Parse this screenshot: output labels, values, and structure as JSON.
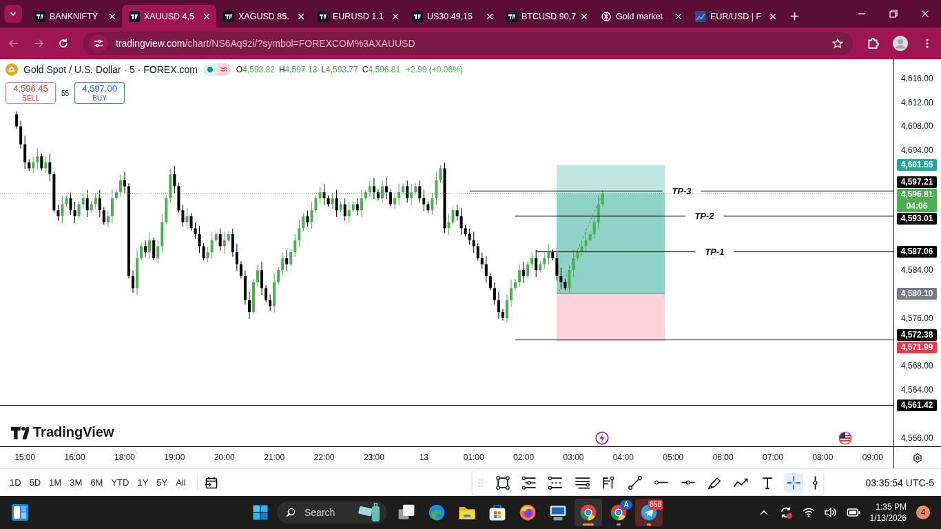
{
  "browser": {
    "tabs": [
      {
        "kind": "tradingview",
        "title": "BANKNIFTY",
        "selected": false
      },
      {
        "kind": "tradingview",
        "title": "XAUUSD 4,5",
        "selected": true
      },
      {
        "kind": "tradingview",
        "title": "XAGUSD 85.",
        "selected": false
      },
      {
        "kind": "tradingview",
        "title": "EURUSD 1.1",
        "selected": false
      },
      {
        "kind": "tradingview",
        "title": "US30 49,15",
        "selected": false
      },
      {
        "kind": "tradingview",
        "title": "BTCUSD 90,7",
        "selected": false
      },
      {
        "kind": "assistant",
        "title": "Gold market",
        "selected": false
      },
      {
        "kind": "news",
        "title": "EUR/USD | F",
        "selected": false
      }
    ],
    "back": {
      "disabled": true
    },
    "forward": {
      "disabled": true
    },
    "address_bar": {
      "domain": "tradingview.com",
      "path": "/chart/NS6Aq9zi/?symbol=FOREXCOM%3AXAUUSD"
    }
  },
  "chart": {
    "legend": {
      "title": "Gold Spot / U.S. Dollar · 5 · FOREX.com",
      "ohlc": [
        {
          "label": "O",
          "value": "4,593.82"
        },
        {
          "label": "H",
          "value": "4,597.13"
        },
        {
          "label": "L",
          "value": "4,593.77"
        },
        {
          "label": "C",
          "value": "4,596.81"
        }
      ],
      "change": "+2.99 (+0.06%)"
    },
    "trade": {
      "sell_price": "4,596.45",
      "sell_label": "SELL",
      "spread": "55",
      "buy_price": "4,597.00",
      "buy_label": "BUY"
    },
    "brand": "TradingView",
    "time_axis": [
      "15:00",
      "16:00",
      "18:00",
      "19:00",
      "20:00",
      "21:00",
      "22:00",
      "23:00",
      "13",
      "01:00",
      "02:00",
      "03:00",
      "04:00",
      "05:00",
      "06:00",
      "07:00",
      "08:00",
      "09:00"
    ],
    "price_axis": [
      "4,616.00",
      "4,612.00",
      "4,608.00",
      "4,604.00",
      "4,584.00",
      "4,576.00",
      "4,568.00",
      "4,564.00",
      "4,556.00"
    ],
    "line_labels": [
      "TP-3",
      "TP-2",
      "TP-1"
    ],
    "price_labels": [
      {
        "text": "4,601.55",
        "color": "#26a69a"
      },
      {
        "text": "4,597.21",
        "color": "#000000"
      },
      {
        "text": "4,596.81",
        "countdown": "04:06",
        "color": "#4caf50"
      },
      {
        "text": "4,593.01",
        "color": "#000000"
      },
      {
        "text": "4,587.06",
        "color": "#000000"
      },
      {
        "text": "4,580.10",
        "color": "#787b86"
      },
      {
        "text": "4,572.38",
        "color": "#000000"
      },
      {
        "text": "4,571.99",
        "color": "#f23645"
      },
      {
        "text": "4,561.42",
        "color": "#000000"
      }
    ]
  },
  "bottom_toolbar": {
    "ranges": [
      "1D",
      "5D",
      "1M",
      "3M",
      "6M",
      "YTD",
      "1Y",
      "5Y",
      "All"
    ],
    "drawing_tools": [
      {
        "kind": "rectangle",
        "selected": false
      },
      {
        "kind": "channel",
        "selected": false
      },
      {
        "kind": "channel-dashed",
        "selected": false
      },
      {
        "kind": "lines",
        "selected": false
      },
      {
        "kind": "fib",
        "selected": false
      },
      {
        "kind": "trendline",
        "selected": false
      },
      {
        "kind": "ray",
        "selected": false
      },
      {
        "kind": "hline",
        "selected": false
      },
      {
        "kind": "brush",
        "selected": false
      },
      {
        "kind": "path",
        "selected": false
      },
      {
        "kind": "text",
        "selected": false
      },
      {
        "kind": "cross",
        "selected": true
      },
      {
        "kind": "vline",
        "selected": false
      }
    ],
    "clock": "03:35:54 UTC-5"
  },
  "taskbar": {
    "search_placeholder": "Search",
    "apps": [
      {
        "kind": "taskview",
        "selected": false,
        "running": false,
        "attention": false
      },
      {
        "kind": "edge",
        "selected": false,
        "running": false,
        "attention": false
      },
      {
        "kind": "explorer",
        "selected": false,
        "running": false,
        "attention": false
      },
      {
        "kind": "store",
        "selected": false,
        "running": false,
        "attention": false
      },
      {
        "kind": "firefox",
        "selected": false,
        "running": false,
        "attention": false
      },
      {
        "kind": "computer",
        "selected": false,
        "running": false,
        "attention": false
      },
      {
        "kind": "chrome",
        "selected": true,
        "running": true,
        "attention": false
      },
      {
        "kind": "chrome-profile",
        "badge": "A",
        "selected": false,
        "running": true,
        "attention": false
      },
      {
        "kind": "telegram",
        "badge": "858",
        "selected": false,
        "running": true,
        "attention": true
      }
    ],
    "time": "1:35 PM",
    "date": "1/13/2026",
    "notifications": "4"
  }
}
